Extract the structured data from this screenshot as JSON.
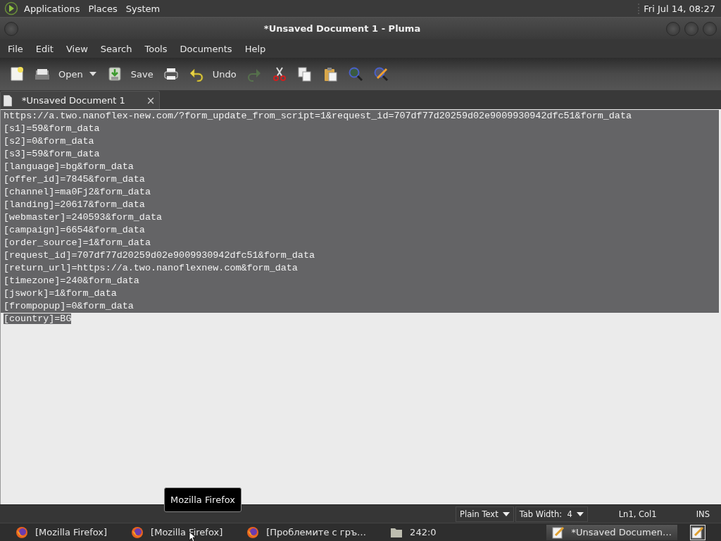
{
  "top_panel": {
    "menus": [
      "Applications",
      "Places",
      "System"
    ],
    "clock": "Fri Jul 14, 08:27"
  },
  "window": {
    "title": "*Unsaved Document 1 - Pluma"
  },
  "menu_bar": [
    "File",
    "Edit",
    "View",
    "Search",
    "Tools",
    "Documents",
    "Help"
  ],
  "toolbar": [
    {
      "kind": "new"
    },
    {
      "kind": "open",
      "label": "Open",
      "dropdown": true
    },
    {
      "kind": "save",
      "label": "Save"
    },
    {
      "kind": "print"
    },
    {
      "kind": "undo",
      "label": "Undo"
    },
    {
      "kind": "redo",
      "disabled": true
    },
    {
      "kind": "cut"
    },
    {
      "kind": "copy"
    },
    {
      "kind": "paste"
    },
    {
      "kind": "find"
    },
    {
      "kind": "replace"
    }
  ],
  "tabs": [
    {
      "label": "*Unsaved Document 1",
      "close": "×",
      "selected": true
    }
  ],
  "editor": {
    "lines": [
      {
        "text": "https://a.two.nanoflex-new.com/?form_update_from_script=1&request_id=707df77d20259d02e9009930942dfc51&form_data",
        "selected": true
      },
      {
        "text": "[s1]=59&form_data",
        "selected": true
      },
      {
        "text": "[s2]=0&form_data",
        "selected": true
      },
      {
        "text": "[s3]=59&form_data",
        "selected": true
      },
      {
        "text": "[language]=bg&form_data",
        "selected": true
      },
      {
        "text": "[offer_id]=7845&form_data",
        "selected": true
      },
      {
        "text": "[channel]=ma0Fj2&form_data",
        "selected": true
      },
      {
        "text": "[landing]=20617&form_data",
        "selected": true
      },
      {
        "text": "[webmaster]=240593&form_data",
        "selected": true
      },
      {
        "text": "[campaign]=6654&form_data",
        "selected": true
      },
      {
        "text": "[order_source]=1&form_data",
        "selected": true
      },
      {
        "text": "[request_id]=707df77d20259d02e9009930942dfc51&form_data",
        "selected": true
      },
      {
        "text": "[return_url]=https://a.two.nanoflexnew.com&form_data",
        "selected": true
      },
      {
        "text": "[timezone]=240&form_data",
        "selected": true
      },
      {
        "text": "[jswork]=1&form_data",
        "selected": true
      },
      {
        "text": "[frompopup]=0&form_data",
        "selected": true
      },
      {
        "text": "[country]=BG",
        "selected": true
      }
    ]
  },
  "status_bar": {
    "language": "Plain Text",
    "tab_width": "Tab Width:  4",
    "position": "Ln1, Col1",
    "mode": "INS"
  },
  "taskbar": {
    "items": [
      {
        "kind": "firefox",
        "label": "[Mozilla Firefox]",
        "selected": false
      },
      {
        "kind": "firefox",
        "label": "[Mozilla Firefox]",
        "selected": false
      },
      {
        "kind": "firefox",
        "label": "[Проблемите с гръ…",
        "selected": false
      },
      {
        "kind": "folder",
        "label": "242:0",
        "selected": false
      },
      {
        "kind": "editor",
        "label": "*Unsaved Documen…",
        "selected": true
      }
    ]
  },
  "tooltip": "Mozilla Firefox"
}
